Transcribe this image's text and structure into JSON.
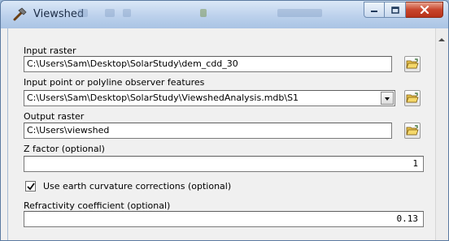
{
  "window": {
    "title": "Viewshed",
    "controls": {
      "minimize": "minimize",
      "maximize": "maximize",
      "close": "close"
    }
  },
  "fields": {
    "input_raster": {
      "label": "Input raster",
      "value": "C:\\Users\\Sam\\Desktop\\SolarStudy\\dem_cdd_30"
    },
    "observer_features": {
      "label": "Input point or polyline observer features",
      "value": "C:\\Users\\Sam\\Desktop\\SolarStudy\\ViewshedAnalysis.mdb\\S1"
    },
    "output_raster": {
      "label": "Output raster",
      "value": "C:\\Users\\viewshed"
    },
    "z_factor": {
      "label": "Z factor (optional)",
      "value": "1"
    },
    "curvature": {
      "label": "Use earth curvature corrections (optional)",
      "checked": true
    },
    "refractivity": {
      "label": "Refractivity coefficient (optional)",
      "value": "0.13"
    }
  },
  "icons": {
    "app": "hammer-icon",
    "browse": "open-folder-icon",
    "dropdown": "chevron-down-icon"
  }
}
